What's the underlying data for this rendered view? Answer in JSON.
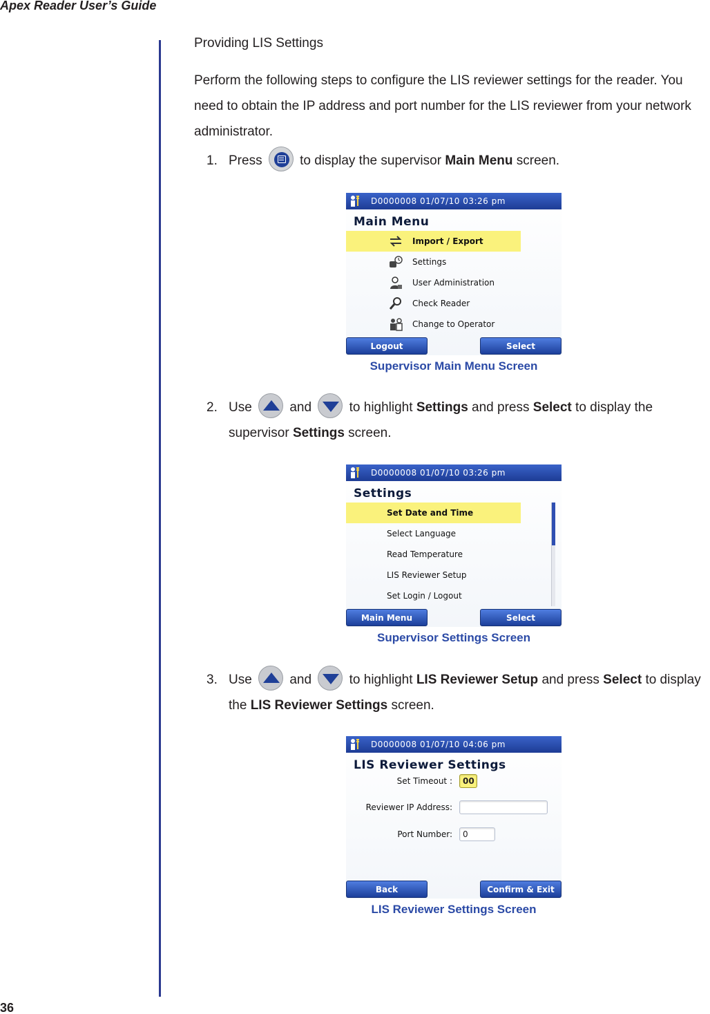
{
  "header": {
    "guide_title": "Apex Reader User’s Guide"
  },
  "footer": {
    "page_number": "36"
  },
  "section": {
    "title": "Providing LIS Settings",
    "intro": "Perform the following steps to configure the LIS reviewer settings for the reader. You need to obtain the IP address and port number for the LIS reviewer from your network administrator."
  },
  "steps": [
    {
      "number": "1.",
      "t1": "Press",
      "t2": "to display the supervisor",
      "b1": "Main Menu",
      "t3": "screen."
    },
    {
      "number": "2.",
      "t1": "Use",
      "and": "and",
      "t2": "to highlight",
      "b1": "Settings",
      "t3": "and press",
      "b2": "Select",
      "t4": "to display the supervisor",
      "b3": "Settings",
      "t5": "screen."
    },
    {
      "number": "3.",
      "t1": "Use",
      "and": "and",
      "t2": "to highlight",
      "b1": "LIS Reviewer Setup",
      "t3": "and press",
      "b2": "Select",
      "t4": "to display the",
      "b3": "LIS Reviewer Settings",
      "t5": "screen."
    }
  ],
  "screens": {
    "main_menu": {
      "status": "D0000008   01/07/10  03:26 pm",
      "title": "Main Menu",
      "items": [
        "Import / Export",
        "Settings",
        "User Administration",
        "Check Reader",
        "Change to Operator"
      ],
      "left_key": "Logout",
      "right_key": "Select",
      "caption": "Supervisor Main Menu Screen"
    },
    "settings": {
      "status": "D0000008   01/07/10  03:26 pm",
      "title": "Settings",
      "items": [
        "Set Date and Time",
        "Select Language",
        "Read Temperature",
        "LIS Reviewer Setup",
        "Set Login / Logout"
      ],
      "left_key": "Main Menu",
      "right_key": "Select",
      "caption": "Supervisor Settings Screen"
    },
    "lis": {
      "status": "D0000008   01/07/10  04:06 pm",
      "title": "LIS Reviewer Settings",
      "timeout_label": "Set Timeout :",
      "timeout_value": "00",
      "ip_label": "Reviewer IP Address:",
      "ip_value": "",
      "port_label": "Port Number:",
      "port_value": "0",
      "left_key": "Back",
      "right_key": "Confirm & Exit",
      "caption": "LIS Reviewer Settings Screen"
    }
  },
  "colors": {
    "accent": "#2b3990",
    "caption": "#2b4aa6",
    "highlight": "#faf27c",
    "statusbar": "#1d3c95"
  },
  "icons": [
    "menu-button-icon",
    "up-arrow-button-icon",
    "down-arrow-button-icon",
    "supervisor-icon",
    "import-export-icon",
    "settings-icon",
    "user-admin-icon",
    "check-reader-icon",
    "change-operator-icon"
  ]
}
